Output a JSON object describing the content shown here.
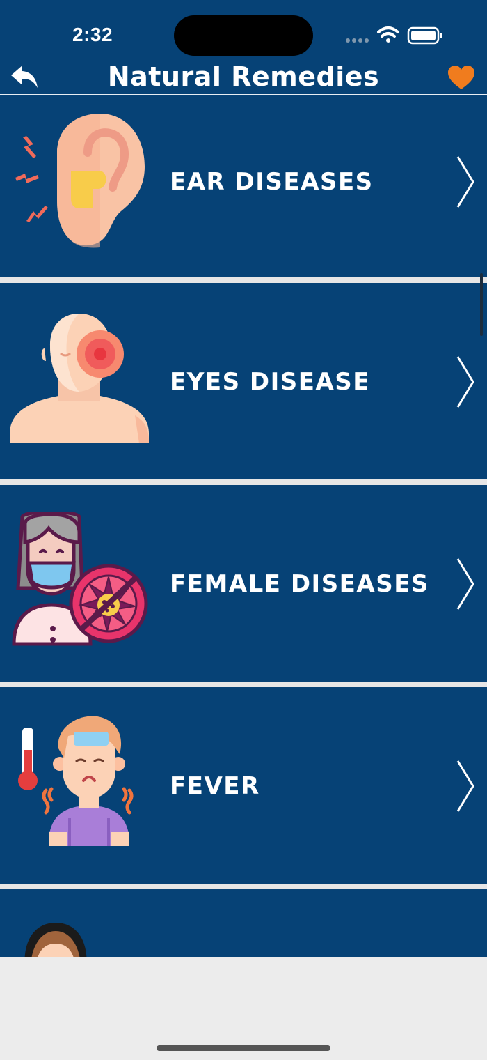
{
  "status_bar": {
    "time": "2:32"
  },
  "nav": {
    "title": "Natural Remedies",
    "back_icon": "back-arrow-icon",
    "favorite_icon": "heart-icon",
    "favorite_color": "#f07c1e"
  },
  "colors": {
    "background": "#064276",
    "divider": "#e6e6e6",
    "text": "#ffffff"
  },
  "list": {
    "items": [
      {
        "label": "EAR DISEASES",
        "icon": "ear-pain-icon"
      },
      {
        "label": "EYES DISEASE",
        "icon": "eye-pain-icon"
      },
      {
        "label": "FEMALE DISEASES",
        "icon": "female-virus-icon"
      },
      {
        "label": "FEVER",
        "icon": "fever-icon"
      }
    ]
  }
}
